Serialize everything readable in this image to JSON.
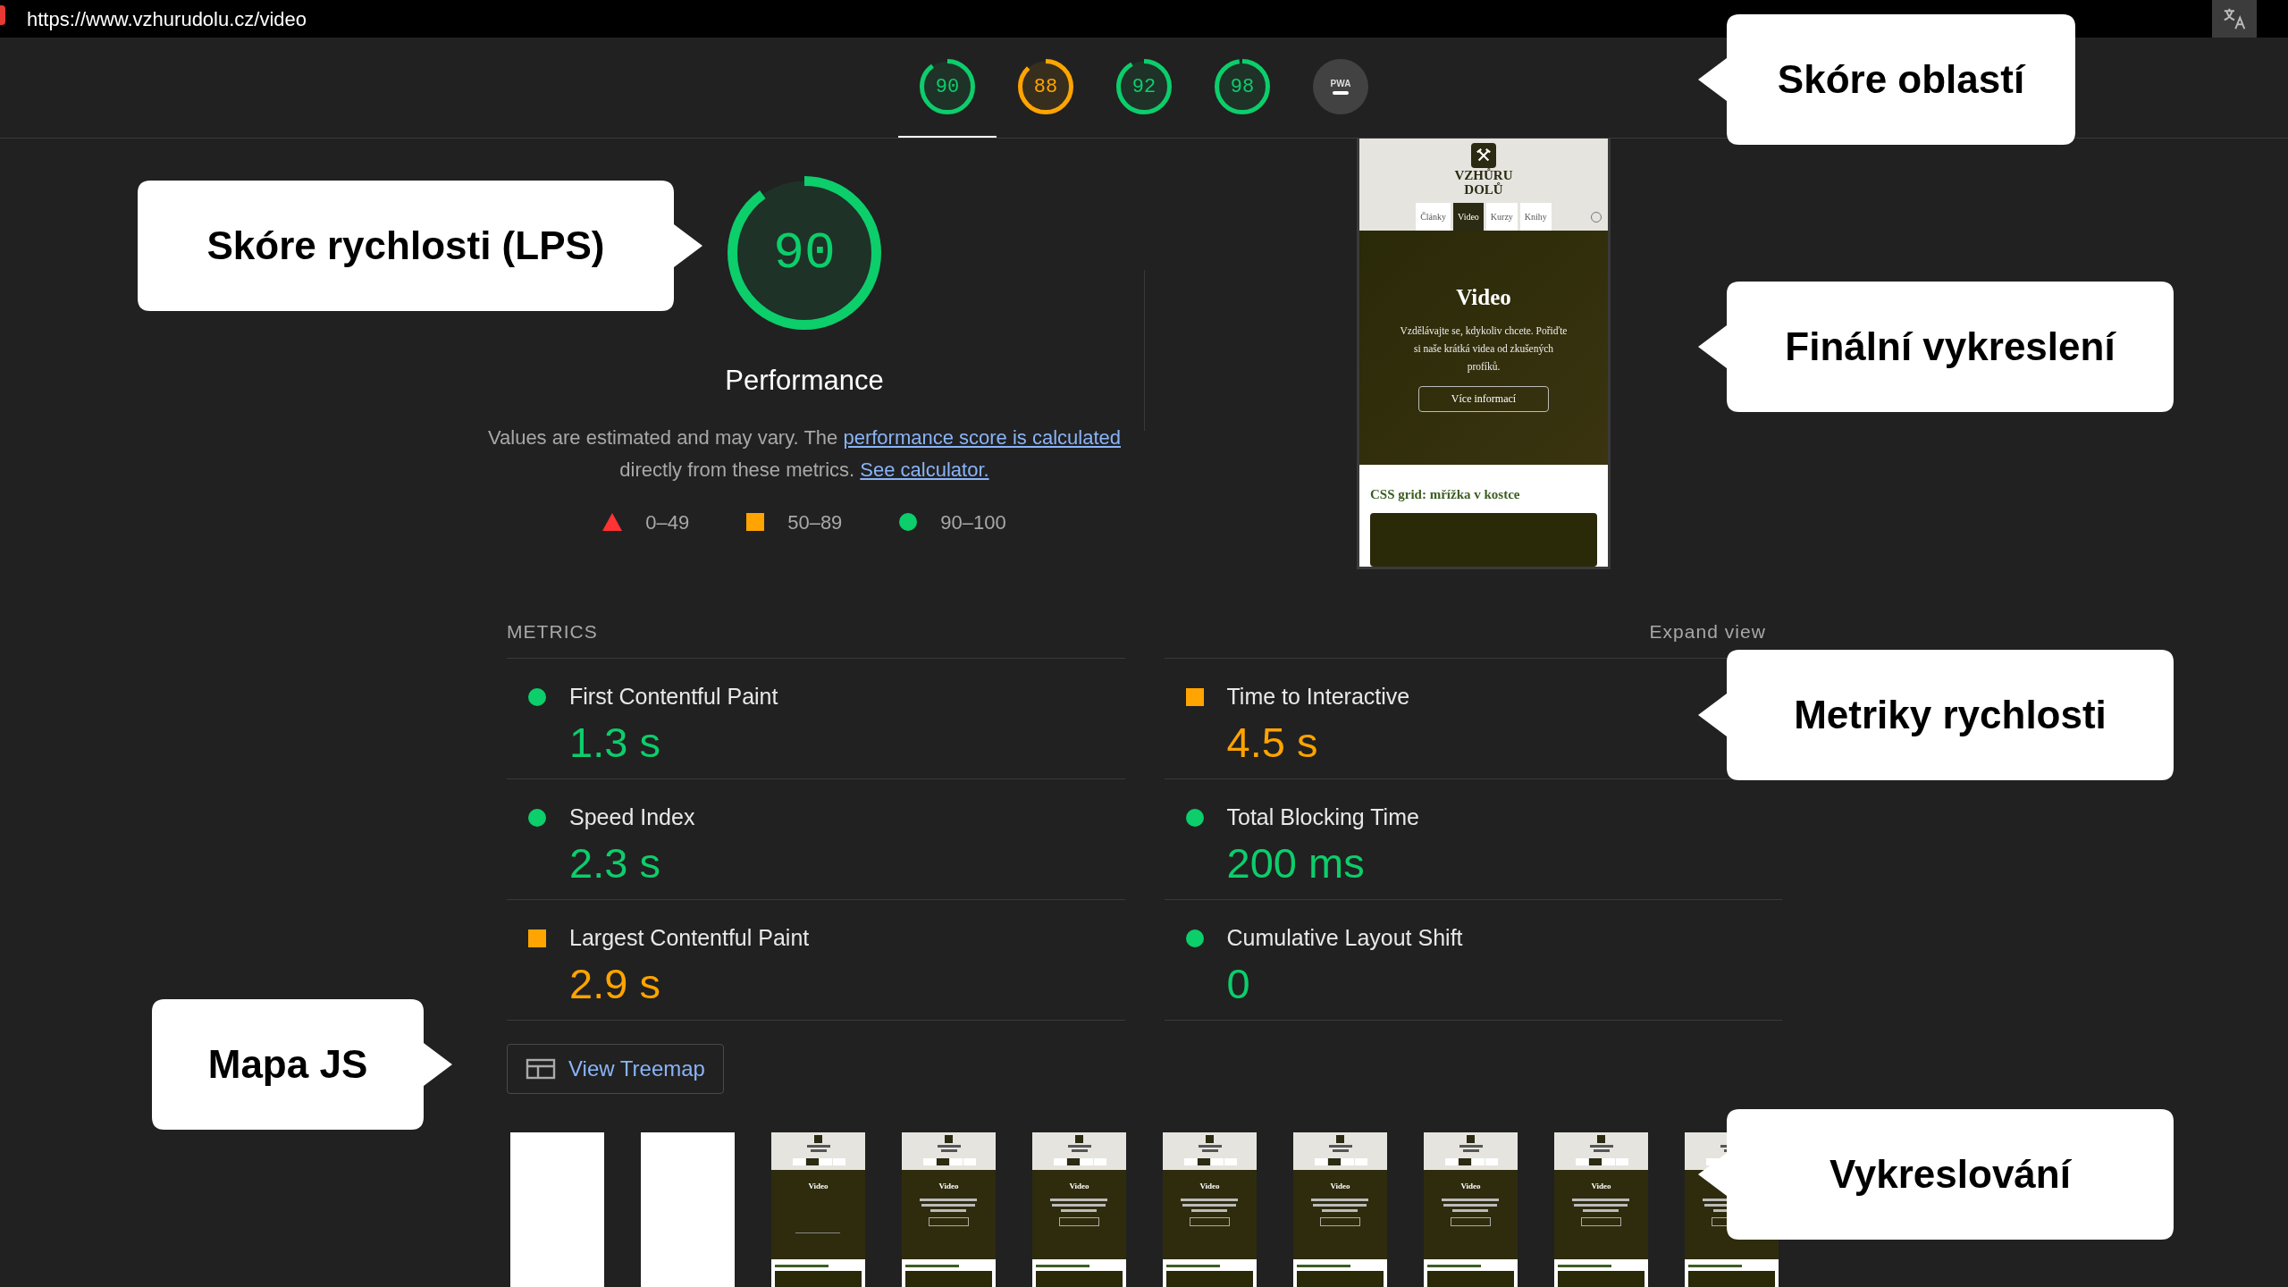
{
  "address_bar": {
    "url": "https://www.vzhurudolu.cz/video"
  },
  "category_scores": [
    {
      "score": "90",
      "color": "#0cce6b",
      "level": 0.9,
      "selected": true
    },
    {
      "score": "88",
      "color": "#ffa400",
      "level": 0.88,
      "selected": false
    },
    {
      "score": "92",
      "color": "#0cce6b",
      "level": 0.92,
      "selected": false
    },
    {
      "score": "98",
      "color": "#0cce6b",
      "level": 0.98,
      "selected": false
    },
    {
      "label": "PWA",
      "selected": false
    }
  ],
  "performance": {
    "score": "90",
    "color": "#0cce6b",
    "level": 0.9,
    "title": "Performance",
    "description": [
      {
        "text": "Values are estimated and may vary. The ",
        "link": false
      },
      {
        "text": "performance score is calculated",
        "link": true
      },
      {
        "text": " directly from these metrics. ",
        "link": false
      },
      {
        "text": "See calculator.",
        "link": true
      }
    ],
    "legend": [
      {
        "range": "0–49",
        "color": "#ff3333"
      },
      {
        "range": "50–89",
        "color": "#ffa400"
      },
      {
        "range": "90–100",
        "color": "#0cce6b"
      }
    ]
  },
  "final_screenshot": {
    "logo": [
      "VZHŮRU",
      "DOLŮ"
    ],
    "tabs": [
      {
        "label": "Články",
        "selected": false
      },
      {
        "label": "Video",
        "selected": true
      },
      {
        "label": "Kurzy",
        "selected": false
      },
      {
        "label": "Knihy",
        "selected": false
      }
    ],
    "hero_title": "Video",
    "hero_text": "Vzdělávajte se, kdykoliv chcete. Pořiďte si naše krátká videa od zkušených profíků.",
    "hero_button": "Více informací",
    "section_heading": "CSS grid: mřížka v kostce"
  },
  "metrics": {
    "heading": "METRICS",
    "expand": "Expand view",
    "items": [
      {
        "name": "First Contentful Paint",
        "value": "1.3 s",
        "color": "#0cce6b"
      },
      {
        "name": "Time to Interactive",
        "value": "4.5 s",
        "color": "#ffa400"
      },
      {
        "name": "Speed Index",
        "value": "2.3 s",
        "color": "#0cce6b"
      },
      {
        "name": "Total Blocking Time",
        "value": "200 ms",
        "color": "#0cce6b"
      },
      {
        "name": "Largest Contentful Paint",
        "value": "2.9 s",
        "color": "#ffa400"
      },
      {
        "name": "Cumulative Layout Shift",
        "value": "0",
        "color": "#0cce6b"
      }
    ]
  },
  "treemap_button": "View Treemap",
  "filmstrip": [
    {
      "kind": "blank"
    },
    {
      "kind": "blank"
    },
    {
      "kind": "loading",
      "title": "Video"
    },
    {
      "kind": "page",
      "title": "Video"
    },
    {
      "kind": "page",
      "title": "Video"
    },
    {
      "kind": "page",
      "title": "Video"
    },
    {
      "kind": "page",
      "title": "Video"
    },
    {
      "kind": "page",
      "title": "Video"
    },
    {
      "kind": "page",
      "title": "Video"
    },
    {
      "kind": "page"
    }
  ],
  "callouts": [
    {
      "text": "Skóre oblastí"
    },
    {
      "text": "Skóre rychlosti (LPS)"
    },
    {
      "text": "Finální vykreslení"
    },
    {
      "text": "Metriky rychlosti"
    },
    {
      "text": "Mapa JS"
    },
    {
      "text": "Vykreslování"
    }
  ]
}
